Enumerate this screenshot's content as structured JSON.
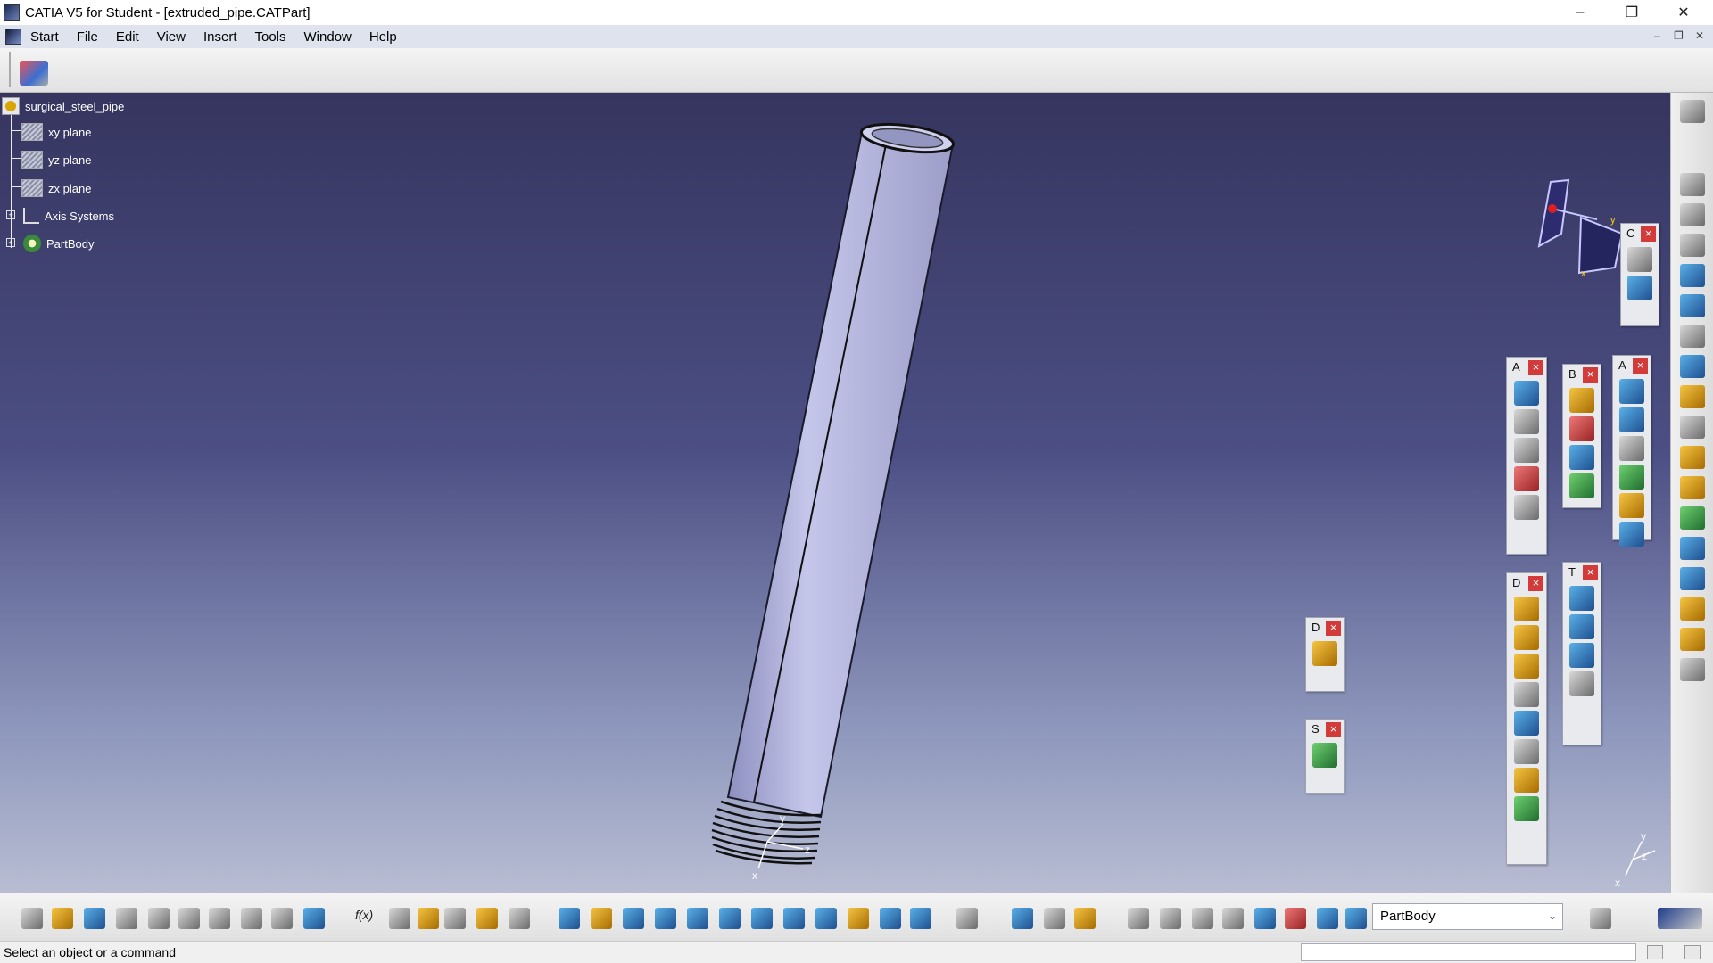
{
  "window": {
    "title": "CATIA V5 for Student - [extruded_pipe.CATPart]",
    "controls": {
      "minimize": "–",
      "restore": "❐",
      "close": "✕"
    }
  },
  "menubar": {
    "items": [
      {
        "label": "Start"
      },
      {
        "label": "File"
      },
      {
        "label": "Edit"
      },
      {
        "label": "View"
      },
      {
        "label": "Insert"
      },
      {
        "label": "Tools"
      },
      {
        "label": "Window"
      },
      {
        "label": "Help"
      }
    ],
    "doc_controls": {
      "minimize": "–",
      "restore": "❐",
      "close": "✕"
    }
  },
  "tree": {
    "root": "surgical_steel_pipe",
    "items": [
      {
        "label": "xy plane",
        "icon": "plane-icon"
      },
      {
        "label": "yz plane",
        "icon": "plane-icon"
      },
      {
        "label": "zx plane",
        "icon": "plane-icon"
      },
      {
        "label": "Axis Systems",
        "icon": "axis-system-icon"
      },
      {
        "label": "PartBody",
        "icon": "partbody-icon"
      }
    ],
    "expander": "+"
  },
  "floating_toolbars": [
    {
      "name": "C",
      "close": "×"
    },
    {
      "name": "A",
      "close": "×"
    },
    {
      "name": "B",
      "close": "×"
    },
    {
      "name": "A",
      "close": "×"
    },
    {
      "name": "D",
      "close": "×"
    },
    {
      "name": "T",
      "close": "×"
    },
    {
      "name": "D",
      "close": "×"
    },
    {
      "name": "S",
      "close": "×"
    }
  ],
  "compass_labels": {
    "y": "y",
    "x": "x"
  },
  "axis_labels": {
    "x": "x",
    "y": "y",
    "z": "z"
  },
  "bottom_toolbar": {
    "body_selector": "PartBody",
    "dropdown_arrow": "⌄",
    "formula_label": "f(x)"
  },
  "statusbar": {
    "message": "Select an object or a command"
  },
  "colors": {
    "viewport_top": "#35355f",
    "viewport_bottom": "#b8bdd3",
    "pipe": "#b4b6dc",
    "close_button": "#d33b3b"
  }
}
